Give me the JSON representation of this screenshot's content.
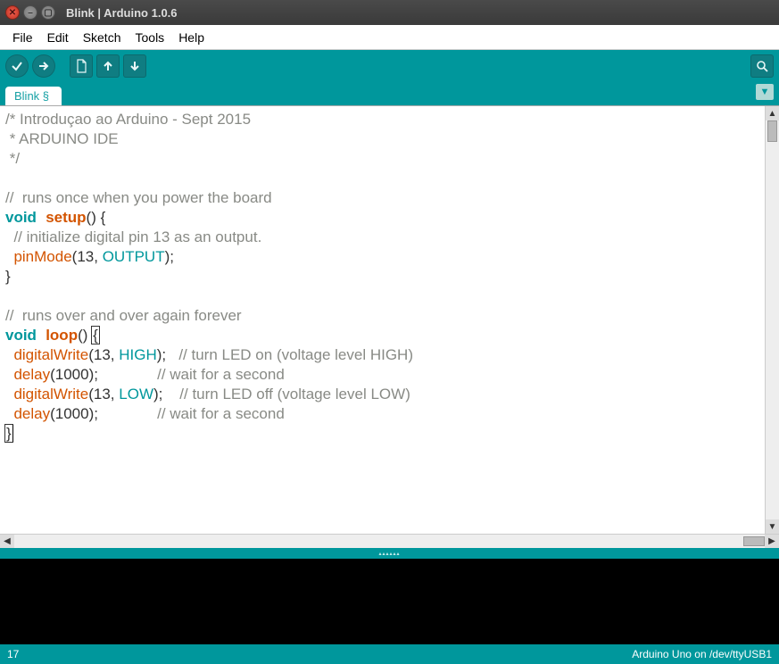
{
  "window": {
    "title": "Blink | Arduino 1.0.6"
  },
  "menu": {
    "file": "File",
    "edit": "Edit",
    "sketch": "Sketch",
    "tools": "Tools",
    "help": "Help"
  },
  "tabs": {
    "active": "Blink §"
  },
  "status": {
    "line": "17",
    "board": "Arduino Uno on /dev/ttyUSB1"
  },
  "code": {
    "l1a": "/* Introduçao ao Arduino - Sept 2015",
    "l2a": " * ARDUINO IDE",
    "l3a": " */",
    "l4a": "",
    "l5a": "//  runs once when you power the board",
    "l6kw": "void",
    "l6fn": "setup",
    "l6p": "() {",
    "l7a": "  // initialize digital pin 13 as an output.",
    "l8sp": "  ",
    "l8call": "pinMode",
    "l8p1": "(13, ",
    "l8const": "OUTPUT",
    "l8p2": ");",
    "l9a": "}",
    "l10a": "",
    "l11a": "//  runs over and over again forever",
    "l12kw": "void",
    "l12fn": "loop",
    "l12p1": "() ",
    "l12brace": "{",
    "l13sp": "  ",
    "l13call": "digitalWrite",
    "l13p1": "(13, ",
    "l13const": "HIGH",
    "l13p2": ");   ",
    "l13c": "// turn LED on (voltage level HIGH)",
    "l14sp": "  ",
    "l14call": "delay",
    "l14p1": "(1000);              ",
    "l14c": "// wait for a second",
    "l15sp": "  ",
    "l15call": "digitalWrite",
    "l15p1": "(13, ",
    "l15const": "LOW",
    "l15p2": ");    ",
    "l15c": "// turn LED off (voltage level LOW)",
    "l16sp": "  ",
    "l16call": "delay",
    "l16p1": "(1000);              ",
    "l16c": "// wait for a second",
    "l17brace": "}"
  }
}
